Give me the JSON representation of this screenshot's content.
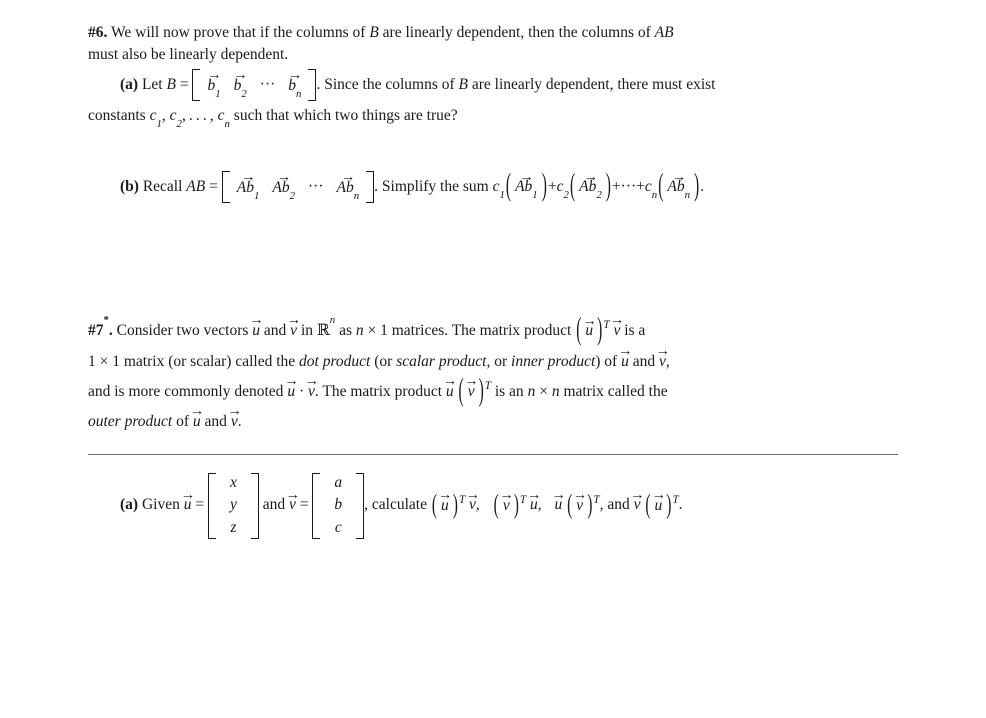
{
  "document": {
    "type": "linear-algebra-worksheet",
    "text_color": "#1a1a1a",
    "background_color": "#ffffff",
    "rule_color": "#6f6f73"
  },
  "problem6": {
    "label": "#6.",
    "stem_line1": "We will now prove that if the columns of",
    "stem_B": "B",
    "stem_line1b": "are linearly dependent, then the columns of",
    "stem_AB": "AB",
    "stem_line2": "must also be linearly dependent.",
    "part_a": {
      "label": "(a)",
      "text_before": "Let",
      "var_B": "B",
      "equals": "=",
      "matrix_entries": [
        "b",
        "b",
        "b"
      ],
      "matrix_subscripts": [
        "1",
        "2",
        "n"
      ],
      "matrix_ellipsis": "···",
      "text_after": ". Since the columns of",
      "B_again": "B",
      "text_after2": "are linearly dependent, there must exist",
      "line2_before": "constants",
      "constants": [
        "c",
        "c",
        "c"
      ],
      "constant_subscripts": [
        "1",
        "2",
        "n"
      ],
      "constants_ellipsis": ", . . . ,",
      "line2_after": "such that which two things are true?"
    },
    "part_b": {
      "label": "(b)",
      "text_before": "Recall",
      "var_AB": "AB",
      "equals": "=",
      "matrix_entries": [
        "Ab",
        "Ab",
        "Ab"
      ],
      "matrix_subscripts": [
        "1",
        "2",
        "n"
      ],
      "matrix_ellipsis": "···",
      "text_after": ". Simplify the sum",
      "terms": [
        {
          "coef": "c",
          "coef_sub": "1",
          "body": "Ab",
          "body_sub": "1",
          "op_after": "+"
        },
        {
          "coef": "c",
          "coef_sub": "2",
          "body": "Ab",
          "body_sub": "2",
          "op_after": "+···+"
        },
        {
          "coef": "c",
          "coef_sub": "n",
          "body": "Ab",
          "body_sub": "n",
          "op_after": "."
        }
      ]
    }
  },
  "problem7": {
    "label": "#7",
    "star": "*",
    "label_period": ".",
    "line1_a": "Consider two vectors",
    "vec_u": "u",
    "line1_and": "and",
    "vec_v": "v",
    "line1_b": "in",
    "field": "R",
    "field_exp": "n",
    "line1_c": "as",
    "dim_n": "n",
    "times": "×",
    "dim_1": "1",
    "line1_d": "matrices. The matrix product",
    "product1_left": "u",
    "product1_T": "T",
    "product1_right": "v",
    "line1_e": "is a",
    "line2_a": "1",
    "line2_times": "×",
    "line2_b": "1",
    "line2_c": "matrix (or scalar) called the",
    "term_dot": "dot product",
    "line2_d": "(or",
    "term_scalar": "scalar product",
    "line2_e": ", or",
    "term_inner": "inner product",
    "line2_f": ") of",
    "line2_u": "u",
    "line2_and": "and",
    "line2_v": "v",
    "line2_comma": ",",
    "line3_a": "and is more commonly denoted",
    "dot_u": "u",
    "dot_op": "·",
    "dot_v": "v",
    "line3_b": ". The matrix product",
    "outer_left": "u",
    "outer_right": "v",
    "outer_T": "T",
    "line3_c": "is an",
    "line3_n1": "n",
    "line3_times": "×",
    "line3_n2": "n",
    "line3_d": "matrix called the",
    "term_outer": "outer product",
    "line4_of": "of",
    "line4_u": "u",
    "line4_and": "and",
    "line4_v": "v",
    "line4_period": ".",
    "part_a": {
      "label": "(a)",
      "text_before": "Given",
      "vec_u": "u",
      "equals": "=",
      "u_entries": [
        "x",
        "y",
        "z"
      ],
      "text_and": "and",
      "vec_v": "v",
      "equals2": "=",
      "v_entries": [
        "a",
        "b",
        "c"
      ],
      "text_calculate": ", calculate",
      "products": [
        {
          "left": "u",
          "T": "T",
          "right": "v",
          "paren_on": "left",
          "sep": ","
        },
        {
          "left": "v",
          "T": "T",
          "right": "u",
          "paren_on": "left",
          "sep": ","
        },
        {
          "left": "u",
          "T": "T",
          "right": "v",
          "paren_on": "right",
          "sep": ", and"
        },
        {
          "left": "v",
          "T": "T",
          "right": "u",
          "paren_on": "right",
          "sep": "."
        }
      ]
    }
  }
}
